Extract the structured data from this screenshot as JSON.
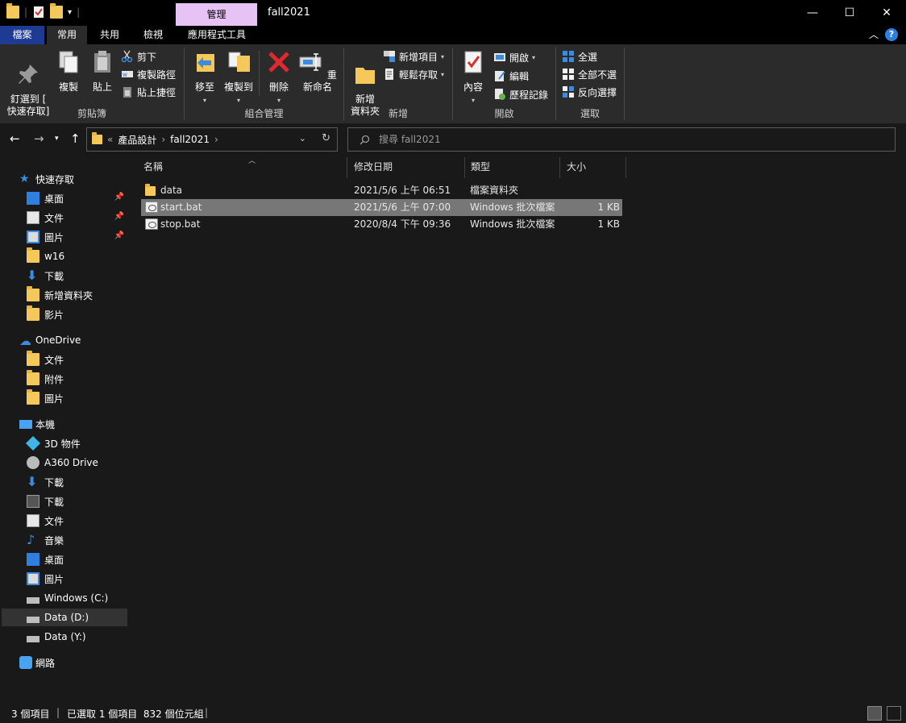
{
  "window": {
    "title": "fall2021",
    "manage_tab": "管理",
    "minimize": "—",
    "maximize": "☐",
    "close": "✕"
  },
  "ribbon_tabs": [
    "檔案",
    "常用",
    "共用",
    "檢視",
    "應用程式工具"
  ],
  "ribbon": {
    "clipboard": {
      "label": "剪貼簿",
      "pin": "釘選到 [\n快速存取]",
      "copy": "複製",
      "paste": "貼上",
      "cut": "剪下",
      "copy_path": "複製路徑",
      "paste_shortcut": "貼上捷徑"
    },
    "organize": {
      "label": "組合管理",
      "move_to": "移至",
      "copy_to": "複製到",
      "delete": "刪除",
      "rename": "重新命名"
    },
    "new": {
      "label": "新增",
      "new_folder": "新增\n資料夾",
      "new_item": "新增項目",
      "easy_access": "輕鬆存取"
    },
    "open": {
      "label": "開啟",
      "properties": "內容",
      "open": "開啟",
      "edit": "編輯",
      "history": "歷程記錄"
    },
    "select": {
      "label": "選取",
      "select_all": "全選",
      "select_none": "全部不選",
      "invert": "反向選擇"
    }
  },
  "address": {
    "overflow": "«",
    "crumbs": [
      "產品設計",
      "fall2021"
    ],
    "search_placeholder": "搜尋 fall2021"
  },
  "nav": {
    "quick_access": "快速存取",
    "quick_items": [
      "桌面",
      "文件",
      "圖片",
      "w16",
      "下載",
      "新增資料夾",
      "影片"
    ],
    "onedrive": "OneDrive",
    "onedrive_items": [
      "文件",
      "附件",
      "圖片"
    ],
    "this_pc": "本機",
    "pc_items": [
      "3D 物件",
      "A360 Drive",
      "下載",
      "下載",
      "文件",
      "音樂",
      "桌面",
      "圖片",
      "Windows (C:)",
      "Data (D:)",
      "Data (Y:)"
    ],
    "network": "網路"
  },
  "columns": {
    "name": "名稱",
    "modified": "修改日期",
    "type": "類型",
    "size": "大小"
  },
  "files": [
    {
      "name": "data",
      "modified": "2021/5/6 上午 06:51",
      "type": "檔案資料夾",
      "size": ""
    },
    {
      "name": "start.bat",
      "modified": "2021/5/6 上午 07:00",
      "type": "Windows 批次檔案",
      "size": "1 KB"
    },
    {
      "name": "stop.bat",
      "modified": "2020/8/4 下午 09:36",
      "type": "Windows 批次檔案",
      "size": "1 KB"
    }
  ],
  "status": {
    "count": "3 個項目",
    "selected": "已選取 1 個項目  832 個位元組"
  },
  "colors": {
    "file_tab": "#1f3a93",
    "manage_tab": "#e7c2f5",
    "folder": "#f4c85a",
    "selected_row": "#777777"
  }
}
